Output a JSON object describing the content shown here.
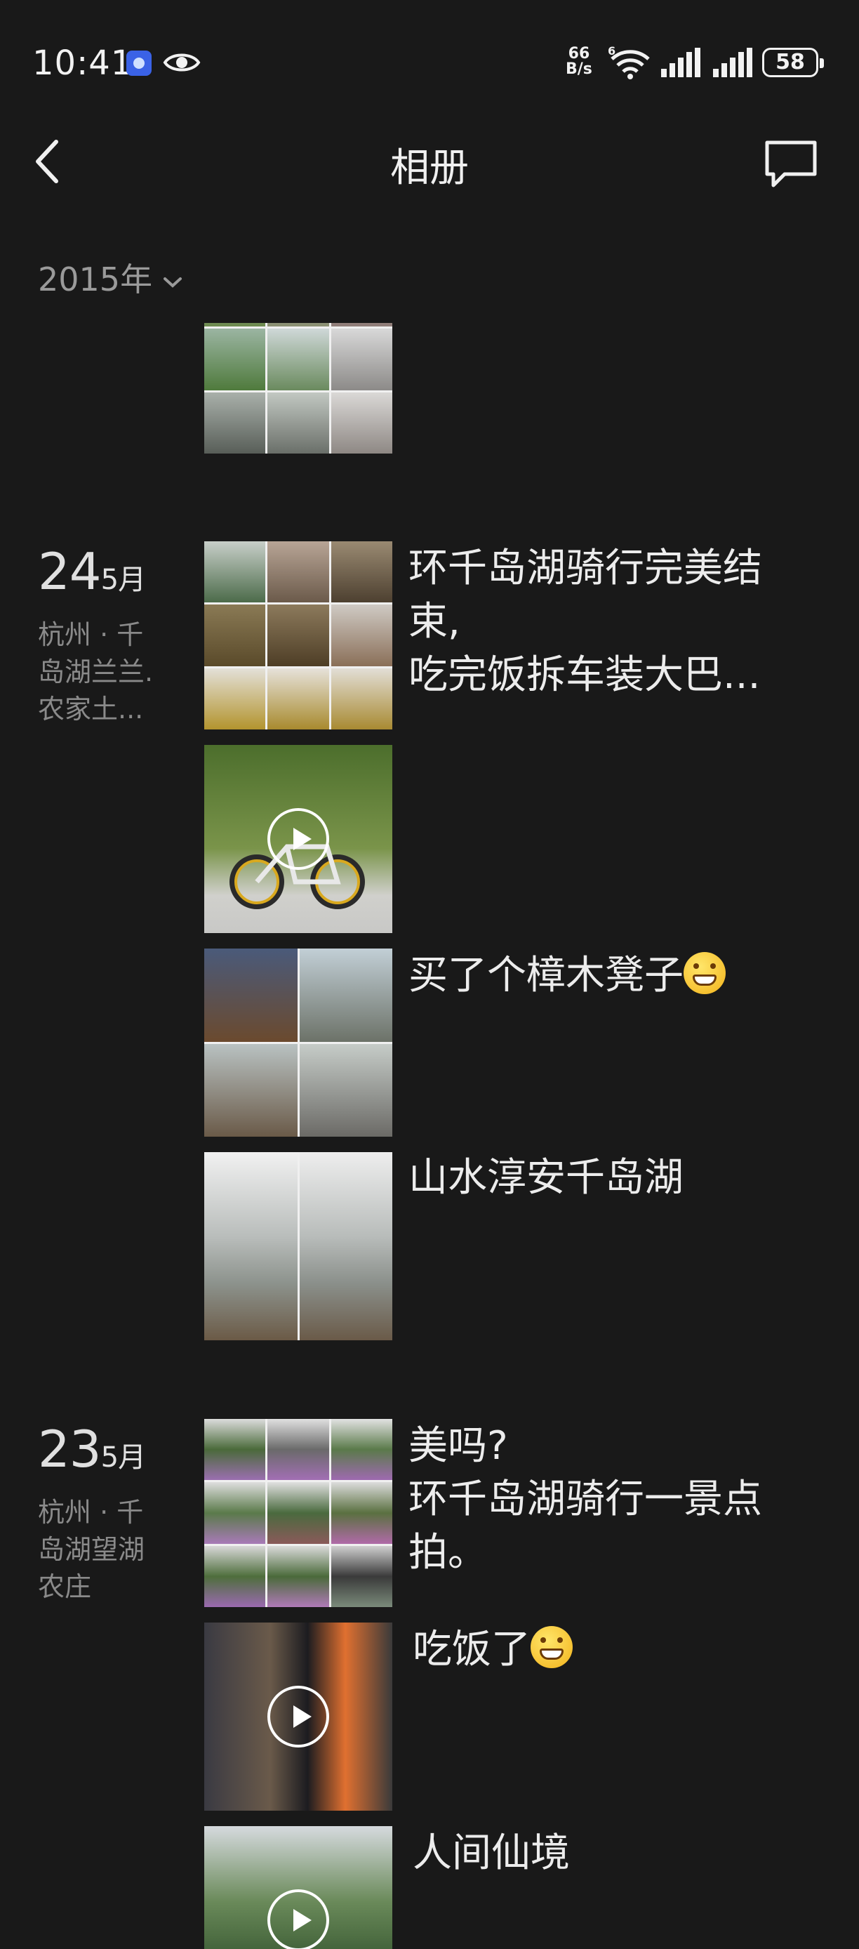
{
  "status_bar": {
    "time": "10:41",
    "net_speed_value": "66",
    "net_speed_unit": "B/s",
    "wifi_label": "6",
    "battery": "58"
  },
  "header": {
    "title": "相册",
    "back_icon": "chevron-left-icon",
    "comment_icon": "comment-icon"
  },
  "filter": {
    "year": "2015年",
    "icon": "chevron-down-icon"
  },
  "colors": {
    "background": "#191919",
    "text": "#ececec",
    "muted": "#8a8a8a"
  },
  "days": [
    {
      "day": "24",
      "month": "5月",
      "location": "杭州 · 千岛湖兰兰.农家土...",
      "posts": [
        {
          "text": "环千岛湖骑行完美结束,\n吃完饭拆车装大巴...",
          "emoji": false,
          "media": "photos-9"
        },
        {
          "text": "",
          "emoji": false,
          "media": "video"
        },
        {
          "text": "买了个樟木凳子",
          "emoji": true,
          "media": "photos-4"
        },
        {
          "text": "山水淳安千岛湖",
          "emoji": false,
          "media": "photos-2"
        }
      ]
    },
    {
      "day": "23",
      "month": "5月",
      "location": "杭州 · 千岛湖望湖农庄",
      "posts": [
        {
          "text": "美吗?\n环千岛湖骑行一景点拍。",
          "emoji": false,
          "media": "photos-9"
        },
        {
          "text": "吃饭了",
          "emoji": true,
          "media": "video"
        },
        {
          "text": "人间仙境",
          "emoji": false,
          "media": "video"
        }
      ]
    }
  ]
}
